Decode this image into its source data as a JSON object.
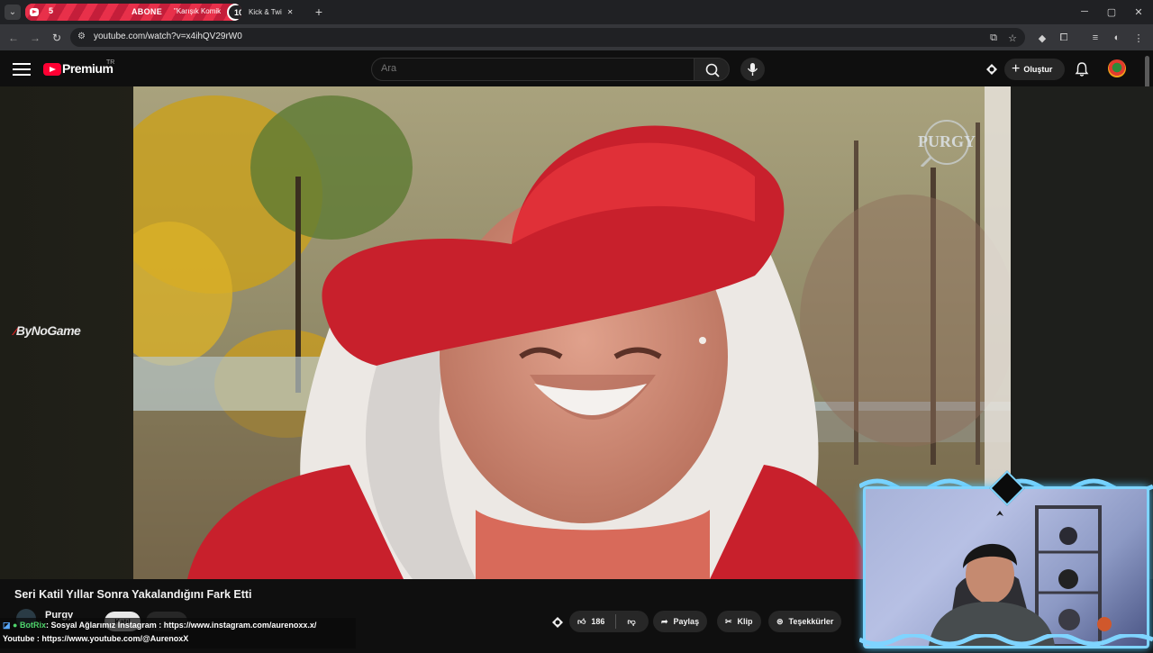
{
  "browser": {
    "tabs": [
      {
        "label_num": "5",
        "label_banner": "ABONE",
        "title": "\"Karışık Komik",
        "badge": "10"
      },
      {
        "title": "Kick & Twi"
      }
    ],
    "new_tab": "+",
    "window_controls": {
      "minimize": "─",
      "maximize": "▢",
      "close": "✕"
    },
    "url": "youtube.com/watch?v=x4ihQV29rW0"
  },
  "youtube": {
    "logo_text": "Premium",
    "region": "TR",
    "search_placeholder": "Ara",
    "create_label": "Oluştur",
    "brand_color": "#ff0033"
  },
  "video": {
    "watermark": "PURGY",
    "sponsor": "ByNoGame",
    "title": "Seri Katil Yıllar Sonra Yakalandığını Fark Etti",
    "channel": "Purgy",
    "join_label": "Katıl",
    "likes": "186",
    "actions": {
      "share": "Paylaş",
      "clip": "Klip",
      "thanks": "Teşekkürler"
    }
  },
  "chat": [
    {
      "user": "BotRix",
      "sep": ":",
      "message": "Sosyal Ağlarımız Instagram : https://www.instagram.com/aurenoxx.x/"
    },
    {
      "user": "",
      "sep": "",
      "message": "Youtube : https://www.youtube.com/@AurenoxX"
    }
  ],
  "colors": {
    "accent_tab": "#e8304a",
    "cam_glow": "#7fd4ff",
    "chat_user": "#4ed36a"
  }
}
